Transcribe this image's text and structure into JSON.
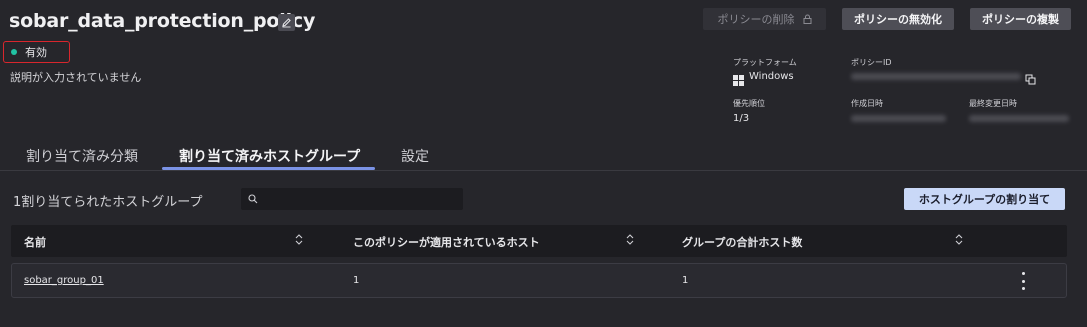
{
  "header": {
    "title": "sobar_data_protection_policy",
    "status": "有効",
    "description": "説明が入力されていません"
  },
  "actions": {
    "delete_label": "ポリシーの削除",
    "deactivate_label": "ポリシーの無効化",
    "duplicate_label": "ポリシーの複製"
  },
  "meta": {
    "platform_label": "プラットフォーム",
    "platform_value": "Windows",
    "policy_id_label": "ポリシーID",
    "priority_label": "優先順位",
    "priority_value": "1/3",
    "created_label": "作成日時",
    "modified_label": "最終変更日時"
  },
  "tabs": [
    {
      "label": "割り当て済み分類",
      "active": false
    },
    {
      "label": "割り当て済みホストグループ",
      "active": true
    },
    {
      "label": "設定",
      "active": false
    }
  ],
  "section": {
    "assigned_count_text": "1割り当てられたホストグループ",
    "search_placeholder": "",
    "assign_button_label": "ホストグループの割り当て"
  },
  "table": {
    "columns": [
      "名前",
      "このポリシーが適用されているホスト",
      "グループの合計ホスト数"
    ],
    "rows": [
      {
        "name": "sobar_group_01",
        "applied_hosts": "1",
        "total_hosts": "1"
      }
    ]
  },
  "colors": {
    "background": "#26262b",
    "status_dot": "#21c2a3",
    "status_highlight_border": "#d8262d",
    "tab_underline": "#7b93e6",
    "primary_button": "#c9d8f7"
  }
}
